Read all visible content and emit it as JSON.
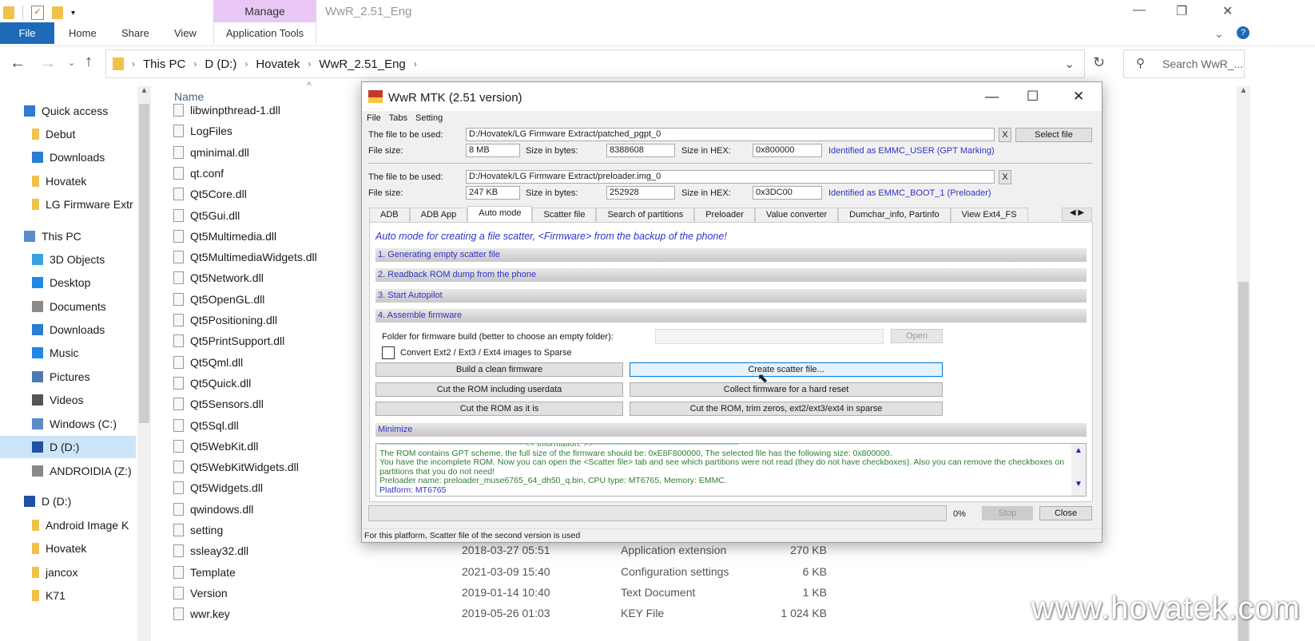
{
  "explorer": {
    "ribbon": {
      "manage": "Manage",
      "window_title": "WwR_2.51_Eng",
      "tabs": [
        "File",
        "Home",
        "Share",
        "View",
        "Application Tools"
      ]
    },
    "breadcrumb": [
      "This PC",
      "D (D:)",
      "Hovatek",
      "WwR_2.51_Eng"
    ],
    "search_placeholder": "Search WwR_...",
    "column_name": "Name",
    "nav": [
      {
        "label": "Quick access",
        "icon": "star-icon",
        "color": "#2b7cd3"
      },
      {
        "label": "Debut",
        "icon": "folder-icon",
        "color": "#f0c24b"
      },
      {
        "label": "Downloads",
        "icon": "download-icon",
        "color": "#2b7cd3"
      },
      {
        "label": "Hovatek",
        "icon": "folder-icon",
        "color": "#f0c24b"
      },
      {
        "label": "LG Firmware Extr",
        "icon": "folder-icon",
        "color": "#f0c24b"
      },
      {
        "label": "This PC",
        "icon": "computer-icon",
        "color": "#5a8dc8"
      },
      {
        "label": "3D Objects",
        "icon": "cube-icon",
        "color": "#3aa0e0"
      },
      {
        "label": "Desktop",
        "icon": "desktop-icon",
        "color": "#1e88e5"
      },
      {
        "label": "Documents",
        "icon": "document-icon",
        "color": "#8a8a8a"
      },
      {
        "label": "Downloads",
        "icon": "download-icon",
        "color": "#2b7cd3"
      },
      {
        "label": "Music",
        "icon": "music-icon",
        "color": "#1e88e5"
      },
      {
        "label": "Pictures",
        "icon": "picture-icon",
        "color": "#4a7ab0"
      },
      {
        "label": "Videos",
        "icon": "video-icon",
        "color": "#555"
      },
      {
        "label": "Windows (C:)",
        "icon": "drive-icon",
        "color": "#5a8dc8"
      },
      {
        "label": "D (D:)",
        "icon": "drive-icon",
        "color": "#2050a0"
      },
      {
        "label": "ANDROIDIA (Z:)",
        "icon": "drive-icon",
        "color": "#888"
      },
      {
        "label": "D (D:)",
        "icon": "drive-icon",
        "color": "#2050a0"
      },
      {
        "label": "Android Image K",
        "icon": "folder-icon",
        "color": "#f0c24b"
      },
      {
        "label": "Hovatek",
        "icon": "folder-icon",
        "color": "#f0c24b"
      },
      {
        "label": "jancox",
        "icon": "folder-icon",
        "color": "#f0c24b"
      },
      {
        "label": "K71",
        "icon": "folder-icon",
        "color": "#f0c24b"
      }
    ],
    "files": [
      {
        "name": "libwinpthread-1.dll"
      },
      {
        "name": "LogFiles"
      },
      {
        "name": "qminimal.dll"
      },
      {
        "name": "qt.conf"
      },
      {
        "name": "Qt5Core.dll"
      },
      {
        "name": "Qt5Gui.dll"
      },
      {
        "name": "Qt5Multimedia.dll"
      },
      {
        "name": "Qt5MultimediaWidgets.dll"
      },
      {
        "name": "Qt5Network.dll"
      },
      {
        "name": "Qt5OpenGL.dll"
      },
      {
        "name": "Qt5Positioning.dll"
      },
      {
        "name": "Qt5PrintSupport.dll"
      },
      {
        "name": "Qt5Qml.dll"
      },
      {
        "name": "Qt5Quick.dll"
      },
      {
        "name": "Qt5Sensors.dll"
      },
      {
        "name": "Qt5Sql.dll"
      },
      {
        "name": "Qt5WebKit.dll"
      },
      {
        "name": "Qt5WebKitWidgets.dll"
      },
      {
        "name": "Qt5Widgets.dll"
      },
      {
        "name": "qwindows.dll"
      },
      {
        "name": "setting"
      },
      {
        "name": "ssleay32.dll",
        "date": "2018-03-27 05:51",
        "type": "Application extension",
        "size": "270 KB"
      },
      {
        "name": "Template",
        "date": "2021-03-09 15:40",
        "type": "Configuration settings",
        "size": "6 KB"
      },
      {
        "name": "Version",
        "date": "2019-01-14 10:40",
        "type": "Text Document",
        "size": "1 KB"
      },
      {
        "name": "wwr.key",
        "date": "2019-05-26 01:03",
        "type": "KEY File",
        "size": "1 024 KB"
      }
    ],
    "watermark": "www.hovatek.com"
  },
  "wwr": {
    "title": "WwR MTK (2.51 version)",
    "logo_text": "WwR MTK",
    "menu": [
      "File",
      "Tabs",
      "Setting"
    ],
    "labels": {
      "file_used": "The file to be used:",
      "file_size": "File size:",
      "size_bytes": "Size in bytes:",
      "size_hex": "Size in HEX:"
    },
    "file1": {
      "path": "D:/Hovatek/LG Firmware Extract/patched_pgpt_0",
      "size": "8 MB",
      "bytes": "8388608",
      "hex": "0x800000",
      "ident": "Identified as EMMC_USER (GPT Marking)"
    },
    "file2": {
      "path": "D:/Hovatek/LG Firmware Extract/preloader.img_0",
      "size": "247 KB",
      "bytes": "252928",
      "hex": "0x3DC00",
      "ident": "Identified as EMMC_BOOT_1 (Preloader)"
    },
    "clear_label": "X",
    "select_file": "Select file",
    "tabs": [
      "ADB",
      "ADB App",
      "Auto mode",
      "Scatter file",
      "Search of partitions",
      "Preloader",
      "Value converter",
      "Dumchar_info, Partinfo",
      "View Ext4_FS"
    ],
    "heading": "Auto mode for creating a file scatter, <Firmware> from the backup of the phone!",
    "sections": [
      "1. Generating empty scatter file",
      "2. Readback ROM dump from the phone",
      "3. Start Autopilot",
      "4. Assemble firmware"
    ],
    "folder_label": "Folder for firmware build (better to choose an empty folder):",
    "folder_value": "",
    "open": "Open",
    "convert_label": "Convert Ext2 / Ext3 / Ext4 images to Sparse",
    "convert_checked": false,
    "buttons": {
      "build": "Build a clean firmware",
      "create_scatter": "Create scatter file...",
      "cut_userdata": "Cut the ROM including userdata",
      "collect": "Collect firmware for a hard reset",
      "cut_as_is": "Cut the ROM as it is",
      "cut_trim": "Cut the ROM, trim zeros, ext2/ext3/ext4 in sparse"
    },
    "minimize": "Minimize",
    "log": [
      "----------------------------------------------------<< Information: >>----------------------------------------------------",
      "The ROM contains GPT scheme, the full size of the firmware should be: 0xE8F800000, The selected file has the following size:  0x800000.",
      "You have the incomplete ROM. Now you can open the <Scatter file> tab and see which partitions were not read (they do not have checkboxes).  Also you can remove the checkboxes on partitions that you do not need!",
      "Preloader name: preloader_muse6765_64_dh50_q.bin, CPU type: MT6765, Memory: EMMC."
    ],
    "log_platform": "Platform: MT6765",
    "progress_percent": 0,
    "progress_text": "0%",
    "stop": "Stop",
    "close": "Close",
    "status": "For this platform, Scatter file of the second version is used"
  }
}
